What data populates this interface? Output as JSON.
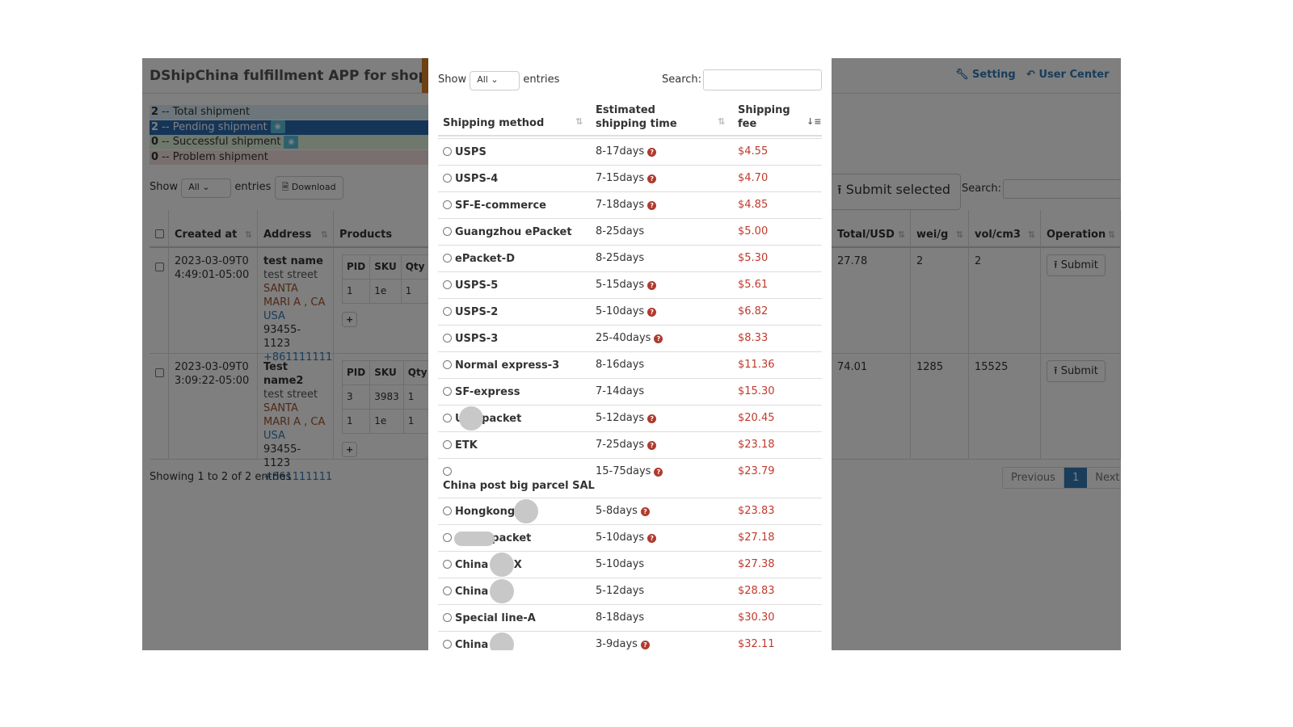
{
  "app": {
    "title": "DShipChina fulfillment APP for shopify",
    "setting": "Setting",
    "user_center": "User Center"
  },
  "stats": [
    {
      "count": "2",
      "label": "-- Total shipment",
      "color": "#d9edf7"
    },
    {
      "count": "2",
      "label": "-- Pending shipment",
      "color": "#2a6bb0"
    },
    {
      "count": "0",
      "label": "-- Successful shipment",
      "color": "#dff0d8"
    },
    {
      "count": "0",
      "label": "-- Problem shipment",
      "color": "#f2dede"
    }
  ],
  "list": {
    "show": "Show",
    "entries": "entries",
    "length": "All",
    "download": "Download",
    "submit_selected": "Submit selected",
    "search": "Search:",
    "search_value": "",
    "columns": [
      "Created at",
      "Address",
      "Products",
      "Total/USD",
      "wei/g",
      "vol/cm3",
      "Operation"
    ],
    "product_cols": [
      "PID",
      "SKU",
      "Qty"
    ],
    "rows": [
      {
        "created": "2023-03-09T04:49:01-05:00",
        "name": "test name",
        "street": "test street",
        "city": "SANTA MARI A , CA",
        "country": "USA",
        "zip": "93455-1123",
        "phone": "+861111111",
        "products": [
          [
            "1",
            "1e",
            "1"
          ]
        ],
        "total": "27.78",
        "wei": "2",
        "vol": "2",
        "op": "Submit"
      },
      {
        "created": "2023-03-09T03:09:22-05:00",
        "name": "Test name2",
        "street": "test street",
        "city": "SANTA MARI A , CA",
        "country": "USA",
        "zip": "93455-1123",
        "phone": "+861111111",
        "products": [
          [
            "3",
            "3983",
            "1"
          ],
          [
            "1",
            "1e",
            "1"
          ]
        ],
        "total": "74.01",
        "wei": "1285",
        "vol": "15525",
        "op": "Submit"
      }
    ],
    "info": "Showing 1 to 2 of 2 entries",
    "prev": "Previous",
    "page": "1",
    "next": "Next"
  },
  "modal": {
    "show": "Show",
    "entries": "entries",
    "length": "All",
    "search": "Search:",
    "search_value": "",
    "columns": [
      "Shipping method",
      "Estimated shipping time",
      "Shipping fee"
    ],
    "methods": [
      {
        "name": "USPS",
        "time": "8-17days",
        "help": true,
        "fee": "$4.55"
      },
      {
        "name": "USPS-4",
        "time": "7-15days",
        "help": true,
        "fee": "$4.70"
      },
      {
        "name": "SF-E-commerce",
        "time": "7-18days",
        "help": true,
        "fee": "$4.85"
      },
      {
        "name": "Guangzhou ePacket",
        "time": "8-25days",
        "help": false,
        "fee": "$5.00"
      },
      {
        "name": "ePacket-D",
        "time": "8-25days",
        "help": false,
        "fee": "$5.30"
      },
      {
        "name": "USPS-5",
        "time": "5-15days",
        "help": true,
        "fee": "$5.61"
      },
      {
        "name": "USPS-2",
        "time": "5-10days",
        "help": true,
        "fee": "$6.82"
      },
      {
        "name": "USPS-3",
        "time": "25-40days",
        "help": true,
        "fee": "$8.33"
      },
      {
        "name": "Normal express-3",
        "time": "8-16days",
        "help": false,
        "fee": "$11.36"
      },
      {
        "name": "SF-express",
        "time": "7-14days",
        "help": false,
        "fee": "$15.30"
      },
      {
        "name": "U     packet",
        "time": "5-12days",
        "help": true,
        "fee": "$20.45",
        "redacted": true
      },
      {
        "name": "ETK",
        "time": "7-25days",
        "help": true,
        "fee": "$23.18"
      },
      {
        "name": "China post big parcel SAL",
        "time": "15-75days",
        "help": true,
        "fee": "$23.79"
      },
      {
        "name": "Hongkong",
        "time": "5-8days",
        "help": true,
        "fee": "$23.83",
        "redacted": true
      },
      {
        "name": "          packet",
        "time": "5-10days",
        "help": true,
        "fee": "$27.18",
        "redacted": true
      },
      {
        "name": "China     EX",
        "time": "5-10days",
        "help": false,
        "fee": "$27.38",
        "redacted": true
      },
      {
        "name": "China",
        "time": "5-12days",
        "help": false,
        "fee": "$28.83",
        "redacted": true
      },
      {
        "name": "Special line-A",
        "time": "8-18days",
        "help": false,
        "fee": "$30.30"
      },
      {
        "name": "China",
        "time": "3-9days",
        "help": true,
        "fee": "$32.11",
        "redacted": true
      }
    ]
  }
}
